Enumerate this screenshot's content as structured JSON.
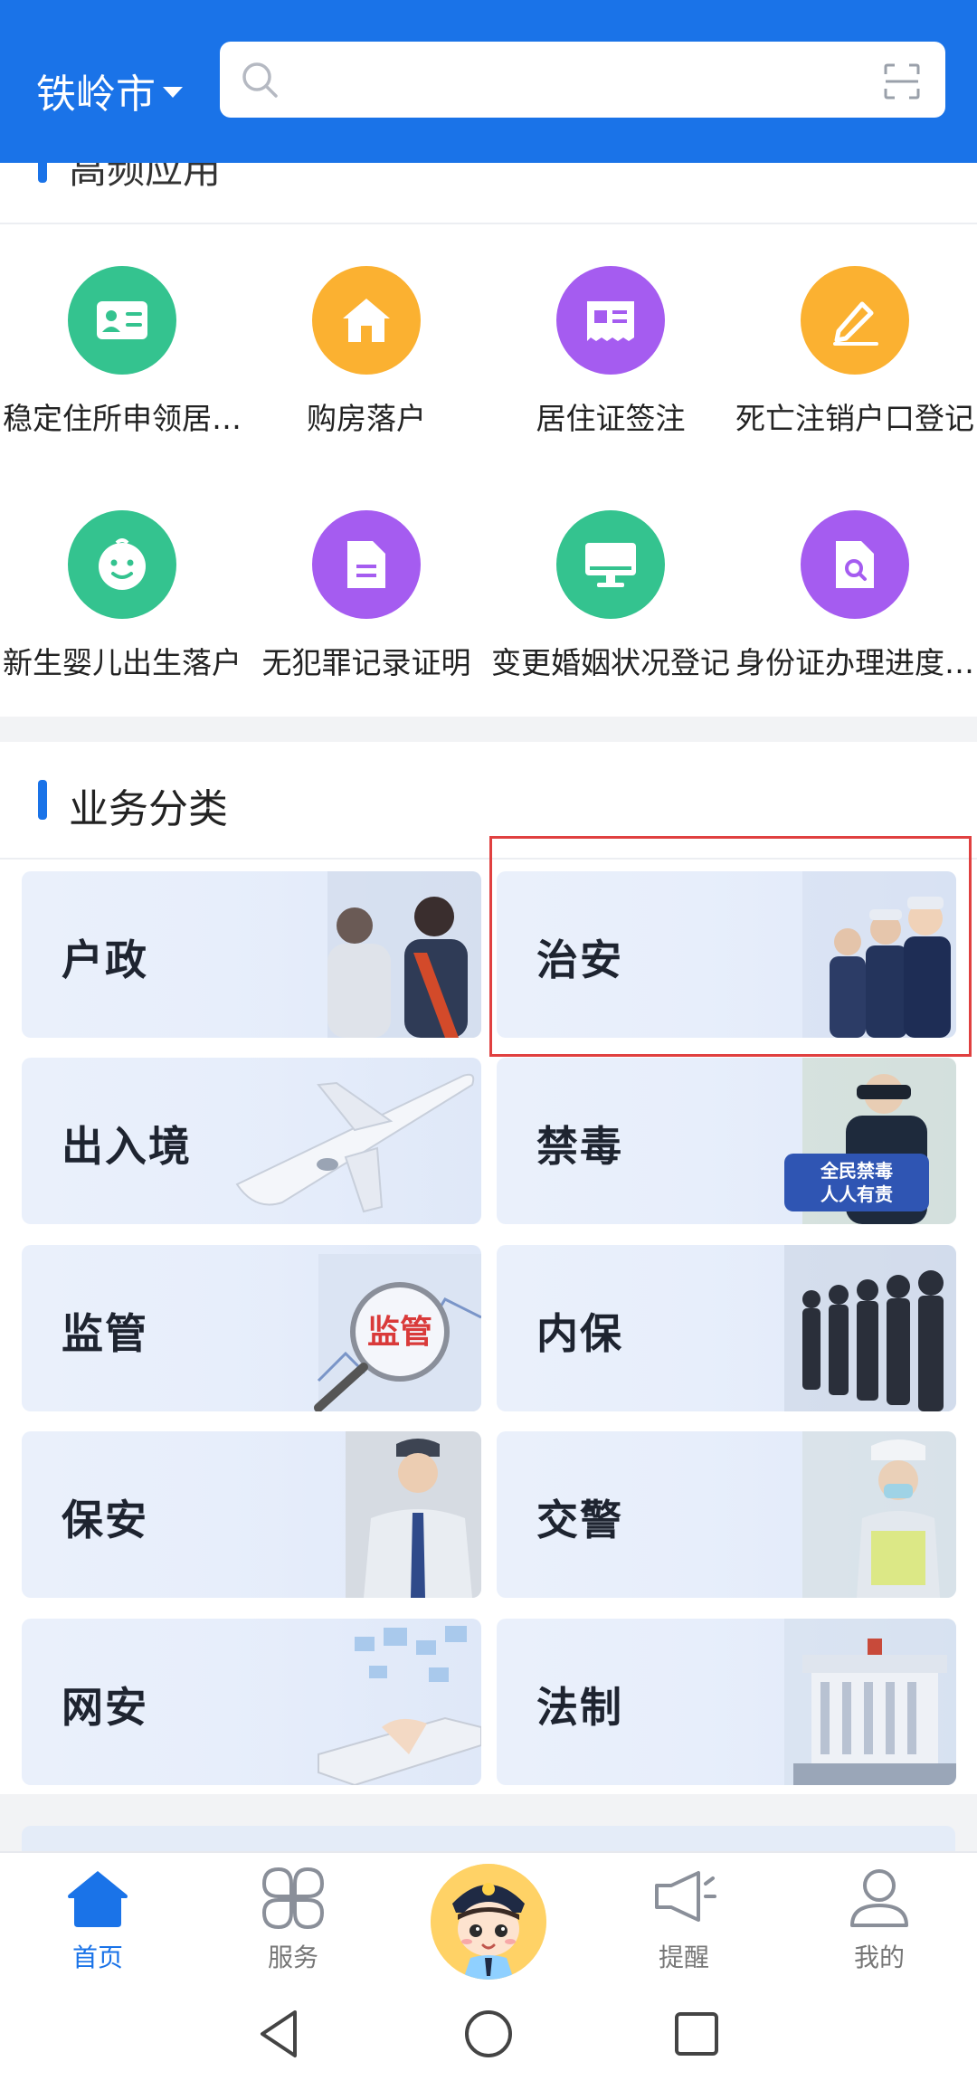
{
  "header": {
    "city": "铁岭市",
    "search_placeholder": ""
  },
  "frequent": {
    "title": "高频应用",
    "apps": [
      {
        "label": "稳定住所申领居住证",
        "icon": "id-card-icon",
        "color": "#34c38f"
      },
      {
        "label": "购房落户",
        "icon": "house-icon",
        "color": "#fbb131"
      },
      {
        "label": "居住证签注",
        "icon": "certificate-icon",
        "color": "#a55cf0"
      },
      {
        "label": "死亡注销户口登记",
        "icon": "pencil-icon",
        "color": "#fbb131"
      },
      {
        "label": "新生婴儿出生落户",
        "icon": "baby-face-icon",
        "color": "#34c38f"
      },
      {
        "label": "无犯罪记录证明",
        "icon": "document-icon",
        "color": "#a55cf0"
      },
      {
        "label": "变更婚姻状况登记",
        "icon": "monitor-icon",
        "color": "#34c38f"
      },
      {
        "label": "身份证办理进度查询",
        "icon": "file-search-icon",
        "color": "#a55cf0"
      }
    ]
  },
  "business": {
    "title": "业务分类",
    "categories": [
      {
        "label": "户政"
      },
      {
        "label": "治安"
      },
      {
        "label": "出入境"
      },
      {
        "label": "禁毒"
      },
      {
        "label": "监管"
      },
      {
        "label": "内保"
      },
      {
        "label": "保安"
      },
      {
        "label": "交警"
      },
      {
        "label": "网安"
      },
      {
        "label": "法制"
      }
    ]
  },
  "tabbar": {
    "tabs": [
      {
        "label": "首页",
        "icon": "home-icon",
        "active": true
      },
      {
        "label": "服务",
        "icon": "apps-icon",
        "active": false
      },
      {
        "label": "提醒",
        "icon": "megaphone-icon",
        "active": false
      },
      {
        "label": "我的",
        "icon": "user-icon",
        "active": false
      }
    ],
    "center": "police-avatar-icon"
  },
  "colors": {
    "brand": "#1a73e8",
    "highlight": "#e04040"
  }
}
